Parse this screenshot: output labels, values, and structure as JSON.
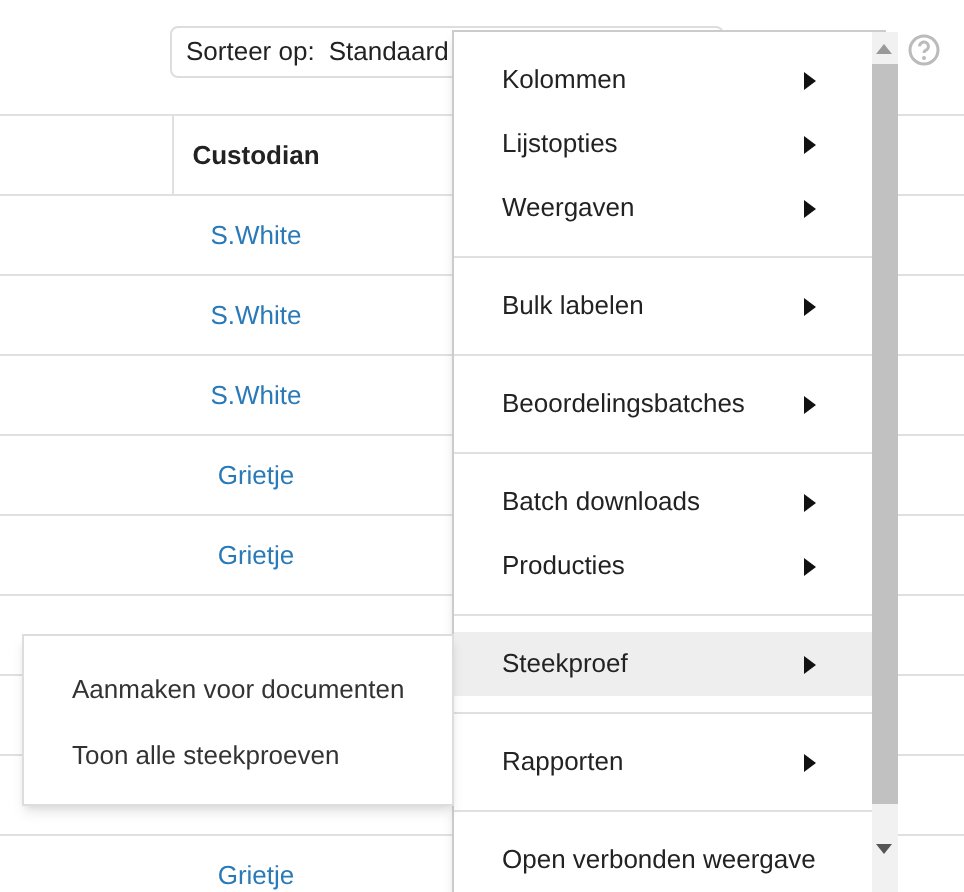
{
  "sort": {
    "label": "Sorteer op:",
    "value": "Standaard"
  },
  "table": {
    "columns": [
      "Custodian"
    ],
    "rows": [
      {
        "custodian": "S.White"
      },
      {
        "custodian": "S.White"
      },
      {
        "custodian": "S.White"
      },
      {
        "custodian": "Grietje"
      },
      {
        "custodian": "Grietje"
      },
      {},
      {},
      {},
      {
        "custodian": "Grietje"
      }
    ]
  },
  "menu": {
    "groups": [
      {
        "items": [
          {
            "label": "Kolommen",
            "has_submenu": true,
            "selected": false
          },
          {
            "label": "Lijstopties",
            "has_submenu": true,
            "selected": false
          },
          {
            "label": "Weergaven",
            "has_submenu": true,
            "selected": false
          }
        ]
      },
      {
        "items": [
          {
            "label": "Bulk labelen",
            "has_submenu": true,
            "selected": false
          }
        ]
      },
      {
        "items": [
          {
            "label": "Beoordelingsbatches",
            "has_submenu": true,
            "selected": false
          }
        ]
      },
      {
        "items": [
          {
            "label": "Batch downloads",
            "has_submenu": true,
            "selected": false
          },
          {
            "label": "Producties",
            "has_submenu": true,
            "selected": false
          }
        ]
      },
      {
        "items": [
          {
            "label": "Steekproef",
            "has_submenu": true,
            "selected": true
          }
        ]
      },
      {
        "items": [
          {
            "label": "Rapporten",
            "has_submenu": true,
            "selected": false
          }
        ]
      },
      {
        "items": [
          {
            "label": "Open verbonden weergave",
            "has_submenu": false,
            "selected": false
          }
        ]
      }
    ]
  },
  "submenu": {
    "items": [
      "Aanmaken voor documenten",
      "Toon alle steekproeven"
    ]
  }
}
